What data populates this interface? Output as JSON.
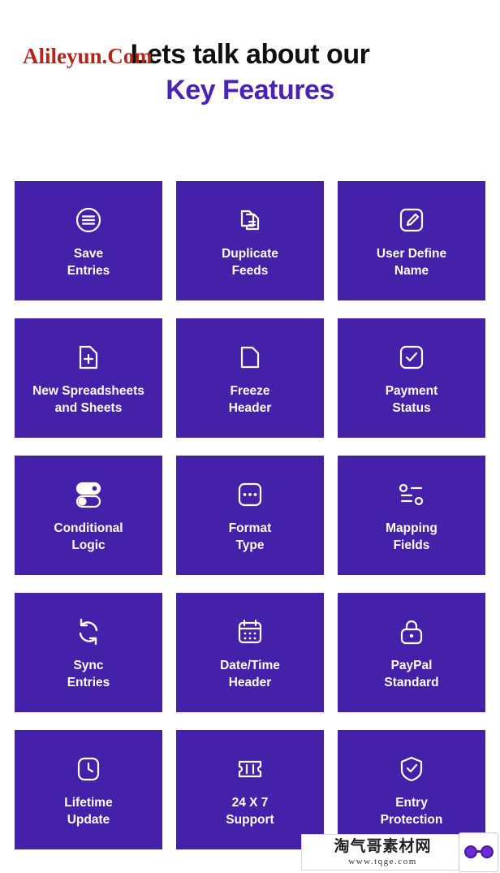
{
  "watermark_top": "Alileyun.Com",
  "headline": {
    "line1": "Lets talk about our",
    "line2": "Key Features"
  },
  "colors": {
    "card_bg": "#4421a8",
    "accent_text": "#4a22b5",
    "headline_text": "#111111",
    "watermark_top": "#b3261e"
  },
  "features": [
    {
      "icon": "save-entries-icon",
      "label": "Save\nEntries"
    },
    {
      "icon": "duplicate-feeds-icon",
      "label": "Duplicate\nFeeds"
    },
    {
      "icon": "user-define-name-icon",
      "label": "User Define\nName"
    },
    {
      "icon": "new-spreadsheets-icon",
      "label": "New Spreadsheets\nand Sheets"
    },
    {
      "icon": "freeze-header-icon",
      "label": "Freeze\nHeader"
    },
    {
      "icon": "payment-status-icon",
      "label": "Payment\nStatus"
    },
    {
      "icon": "conditional-logic-icon",
      "label": "Conditional\nLogic"
    },
    {
      "icon": "format-type-icon",
      "label": "Format\nType"
    },
    {
      "icon": "mapping-fields-icon",
      "label": "Mapping\nFields"
    },
    {
      "icon": "sync-entries-icon",
      "label": "Sync\nEntries"
    },
    {
      "icon": "date-time-header-icon",
      "label": "Date/Time\nHeader"
    },
    {
      "icon": "paypal-standard-icon",
      "label": "PayPal\nStandard"
    },
    {
      "icon": "lifetime-update-icon",
      "label": "Lifetime\nUpdate"
    },
    {
      "icon": "support-24x7-icon",
      "label": "24 X 7\nSupport"
    },
    {
      "icon": "entry-protection-icon",
      "label": "Entry\nProtection"
    }
  ],
  "watermark_bottom": {
    "cn": "淘气哥素材网",
    "url": "www.tqge.com"
  }
}
